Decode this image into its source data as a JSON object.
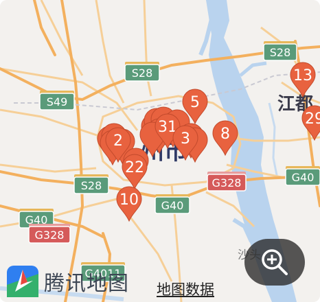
{
  "map": {
    "city_label": "州市",
    "east_city_label": "江都",
    "district_label": "沙头",
    "colors": {
      "land": "#f3f1ee",
      "water": "#b9d3ee",
      "highway": "#f3b05e",
      "road": "#f6cf97",
      "shield_green": "#5a9b7a",
      "shield_red": "#d55a5a",
      "pin": "#e8623f"
    }
  },
  "shields": [
    {
      "id": "s28-top-right",
      "text": "S28",
      "color": "green"
    },
    {
      "id": "s28-center",
      "text": "S28",
      "color": "green"
    },
    {
      "id": "s49",
      "text": "S49",
      "color": "green"
    },
    {
      "id": "s28-left",
      "text": "S28",
      "color": "green"
    },
    {
      "id": "g328-center",
      "text": "G328",
      "color": "red"
    },
    {
      "id": "g40-center",
      "text": "G40",
      "color": "green"
    },
    {
      "id": "g40-left",
      "text": "G40",
      "color": "green"
    },
    {
      "id": "g328-left",
      "text": "G328",
      "color": "red"
    },
    {
      "id": "g40-right",
      "text": "G40",
      "color": "green"
    },
    {
      "id": "g4011-bottom",
      "text": "G4011",
      "color": "green"
    }
  ],
  "markers": [
    {
      "id": "m2",
      "label": "2"
    },
    {
      "id": "m22",
      "label": "22"
    },
    {
      "id": "m10",
      "label": "10"
    },
    {
      "id": "m5",
      "label": "5"
    },
    {
      "id": "m31",
      "label": "31"
    },
    {
      "id": "m3",
      "label": "3"
    },
    {
      "id": "m8",
      "label": "8"
    },
    {
      "id": "m13",
      "label": "13"
    },
    {
      "id": "m29",
      "label": "29"
    }
  ],
  "logo": {
    "text": "腾讯地图",
    "icon": "tencent-map-logo-icon"
  },
  "map_data_link": "地图数据",
  "zoom": {
    "icon": "zoom-in-magnifier-icon"
  }
}
